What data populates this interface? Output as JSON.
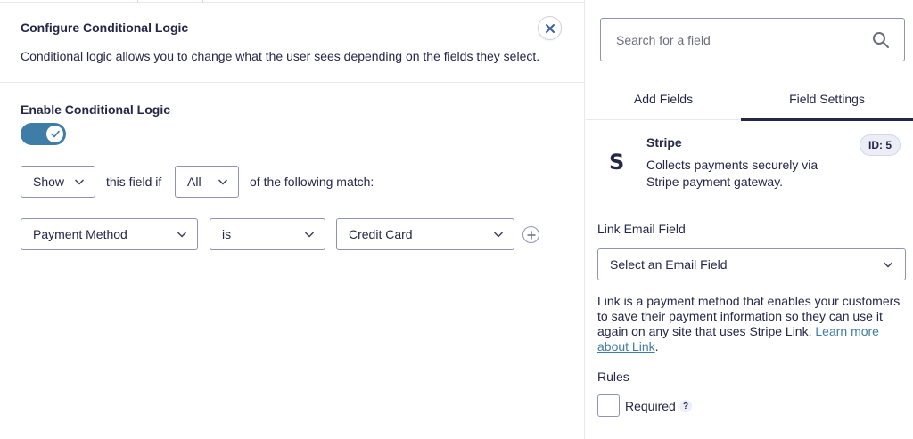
{
  "modal": {
    "title": "Configure Conditional Logic",
    "description": "Conditional logic allows you to change what the user sees depending on the fields they select.",
    "close_icon": "close-icon"
  },
  "logic": {
    "enable_label": "Enable Conditional Logic",
    "enabled": true,
    "action_value": "Show",
    "this_field_if": "this field if",
    "match_value": "All",
    "of_following": "of the following match:"
  },
  "rule": {
    "field_value": "Payment Method",
    "operator_value": "is",
    "compare_value": "Credit Card",
    "add_icon": "plus-circle-icon"
  },
  "sidebar": {
    "search_placeholder": "Search for a field",
    "tabs": [
      {
        "label": "Add Fields",
        "active": false
      },
      {
        "label": "Field Settings",
        "active": true
      }
    ],
    "field": {
      "icon_letter": "S",
      "title": "Stripe",
      "description": "Collects payments securely via Stripe payment gateway.",
      "id_badge": "ID: 5"
    },
    "link_email": {
      "label": "Link Email Field",
      "value": "Select an Email Field",
      "description_text": "Link is a payment method that enables your customers to save their payment information so they can use it again on any site that uses Stripe Link. ",
      "link_text": "Learn more about Link",
      "description_end": "."
    },
    "rules": {
      "label": "Rules",
      "required_label": "Required",
      "required_checked": false,
      "help_glyph": "?"
    }
  },
  "colors": {
    "text": "#242748",
    "toggle_on": "#3e7da6",
    "link": "#3e7da6",
    "border": "#9092b2"
  }
}
